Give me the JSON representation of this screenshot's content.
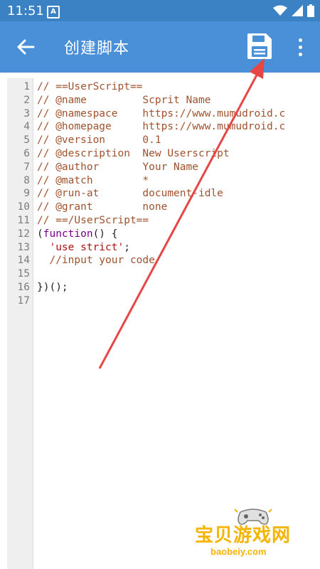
{
  "status_bar": {
    "time": "11:51",
    "notification_badge": "A"
  },
  "app_bar": {
    "title": "创建脚本",
    "back_icon": "arrow-left-icon",
    "save_icon": "floppy-disk-icon",
    "more_icon": "more-vertical-icon"
  },
  "editor": {
    "line_numbers": [
      "1",
      "2",
      "3",
      "4",
      "5",
      "6",
      "7",
      "8",
      "9",
      "10",
      "11",
      "12",
      "13",
      "14",
      "15",
      "16",
      "17"
    ]
  },
  "code_lines": [
    {
      "t": "// ==UserScript=="
    },
    {
      "t": "// @name         Scprit Name"
    },
    {
      "t": "// @namespace    https://www.mumudroid.c"
    },
    {
      "t": "// @homepage     https://www.mumudroid.c"
    },
    {
      "t": "// @version      0.1"
    },
    {
      "t": "// @description  New Userscript"
    },
    {
      "t": "// @author       Your Name"
    },
    {
      "t": "// @match        *"
    },
    {
      "t": "// @run-at       document-idle"
    },
    {
      "t": "// @grant        none"
    },
    {
      "t": "// ==/UserScript=="
    },
    {
      "a": "(",
      "kw": "function",
      "b": "() {"
    },
    {
      "indent": "  ",
      "str": "'use strict'",
      "tail": ";"
    },
    {
      "indent": "  ",
      "comment": "//input your code"
    },
    {
      "t": ""
    },
    {
      "t": "})();",
      "plain": true
    },
    {
      "t": ""
    }
  ],
  "watermark": {
    "text": "宝贝游戏网",
    "url": "baobeiy.com"
  },
  "colors": {
    "status_bar": "#3b82c4",
    "app_bar": "#4a90d9",
    "arrow": "#e84545",
    "comment": "#a0522d",
    "keyword": "#770088",
    "string": "#aa1111"
  }
}
